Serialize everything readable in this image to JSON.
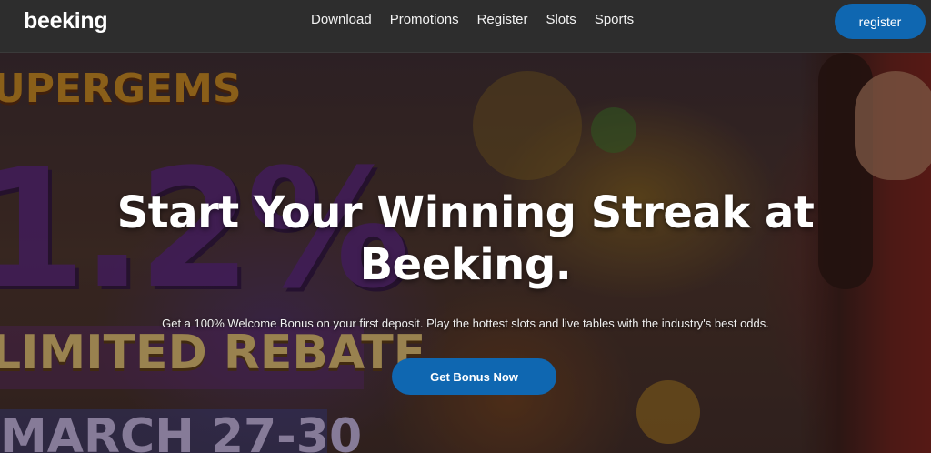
{
  "header": {
    "logo": "beeking",
    "nav": [
      "Download",
      "Promotions",
      "Register",
      "Slots",
      "Sports"
    ],
    "register_label": "register"
  },
  "hero": {
    "title_line1": "Start Your Winning Streak at",
    "title_line2": "Beeking.",
    "subtitle": "Get a 100% Welcome Bonus on your first deposit. Play the hottest slots and live tables with the industry's best odds.",
    "cta_label": "Get Bonus Now",
    "art": {
      "game_name": "UPERGEMS",
      "percent": "1.2%",
      "rebate": "LIMITED REBATE",
      "date": "MARCH 27-30"
    }
  },
  "colors": {
    "header_bg": "#2d2d2d",
    "accent": "#0f67b1",
    "text": "#ffffff"
  }
}
